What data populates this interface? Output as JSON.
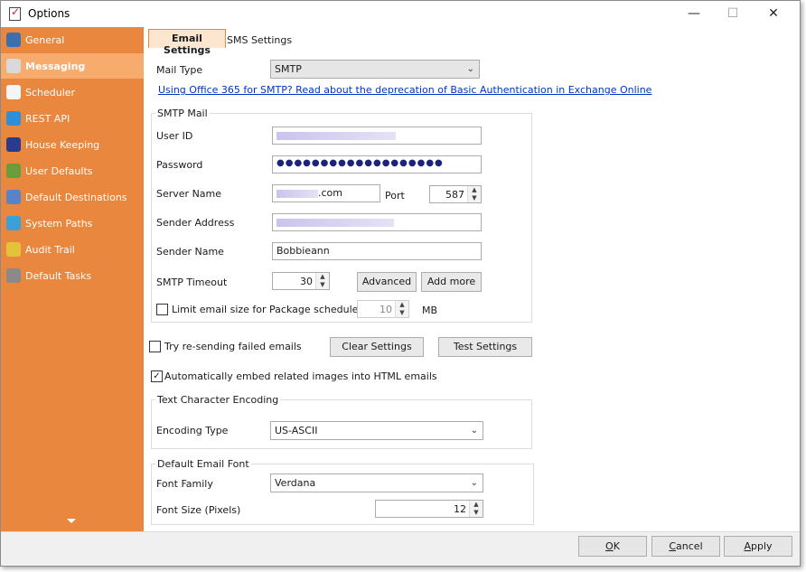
{
  "window": {
    "title": "Options",
    "minimize": "—",
    "maximize": "☐",
    "close": "✕"
  },
  "sidebar": {
    "items": [
      {
        "label": "General",
        "icon": "clipboard-icon",
        "color": "#3b6fb0"
      },
      {
        "label": "Messaging",
        "icon": "envelope-icon",
        "color": "#d9d9d9"
      },
      {
        "label": "Scheduler",
        "icon": "clock-icon",
        "color": "#f5f5f5"
      },
      {
        "label": "REST API",
        "icon": "network-icon",
        "color": "#2f8fd6"
      },
      {
        "label": "House Keeping",
        "icon": "monitor-icon",
        "color": "#2a3a8c"
      },
      {
        "label": "User Defaults",
        "icon": "users-icon",
        "color": "#6a9c3a"
      },
      {
        "label": "Default Destinations",
        "icon": "folder-icon",
        "color": "#5a82c8"
      },
      {
        "label": "System Paths",
        "icon": "globe-icon",
        "color": "#3aa0d8"
      },
      {
        "label": "Audit Trail",
        "icon": "key-icon",
        "color": "#e4c23a"
      },
      {
        "label": "Default Tasks",
        "icon": "document-icon",
        "color": "#8a8a8a"
      }
    ],
    "active_index": 1,
    "accent": "#e9873f"
  },
  "tabs": {
    "email": "Email Settings",
    "sms": "SMS Settings"
  },
  "mail_type": {
    "label": "Mail Type",
    "value": "SMTP"
  },
  "office_link": "Using Office 365 for SMTP? Read about the deprecation of Basic Authentication in Exchange Online",
  "smtp": {
    "group_title": "SMTP Mail",
    "user_id_label": "User ID",
    "password_label": "Password",
    "password_value": "●●●●●●●●●●●●●●●●●●●",
    "server_label": "Server Name",
    "server_suffix": ".com",
    "port_label": "Port",
    "port_value": "587",
    "sender_address_label": "Sender Address",
    "sender_name_label": "Sender Name",
    "sender_name_value": "Bobbieann",
    "timeout_label": "SMTP Timeout",
    "timeout_value": "30",
    "advanced_btn": "Advanced",
    "add_more_btn": "Add more",
    "limit_label": "Limit email size for Package schedules",
    "limit_value": "10",
    "limit_unit": "MB",
    "limit_checked": false
  },
  "retry": {
    "label": "Try re-sending failed emails",
    "checked": false
  },
  "clear_btn": "Clear Settings",
  "test_btn": "Test Settings",
  "embed": {
    "label": "Automatically embed related images into HTML emails",
    "checked": true
  },
  "encoding": {
    "group_title": "Text Character Encoding",
    "label": "Encoding Type",
    "value": "US-ASCII"
  },
  "font": {
    "group_title": "Default Email Font",
    "family_label": "Font Family",
    "family_value": "Verdana",
    "size_label": "Font Size (Pixels)",
    "size_value": "12"
  },
  "footer": {
    "ok": "OK",
    "cancel": "Cancel",
    "apply": "Apply"
  }
}
